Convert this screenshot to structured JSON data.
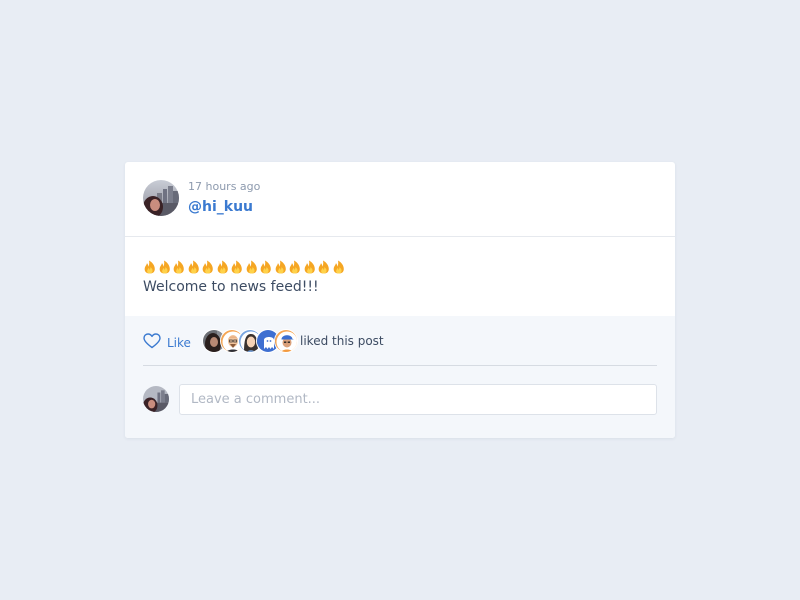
{
  "post": {
    "timestamp": "17 hours ago",
    "username": "@hi_kuu",
    "emoji_icon": "fire-emoji",
    "emoji_count": 14,
    "message": "Welcome to news feed!!!"
  },
  "likes": {
    "like_label": "Like",
    "liked_text": "liked this post",
    "likers": [
      {
        "icon": "photo-avatar"
      },
      {
        "icon": "bald-man-avatar"
      },
      {
        "icon": "woman-avatar"
      },
      {
        "icon": "ghost-avatar"
      },
      {
        "icon": "cap-man-avatar"
      }
    ]
  },
  "comment": {
    "placeholder": "Leave a comment..."
  },
  "colors": {
    "background": "#e8edf4",
    "accent": "#3b7ad0",
    "footer": "#f4f7fb"
  }
}
